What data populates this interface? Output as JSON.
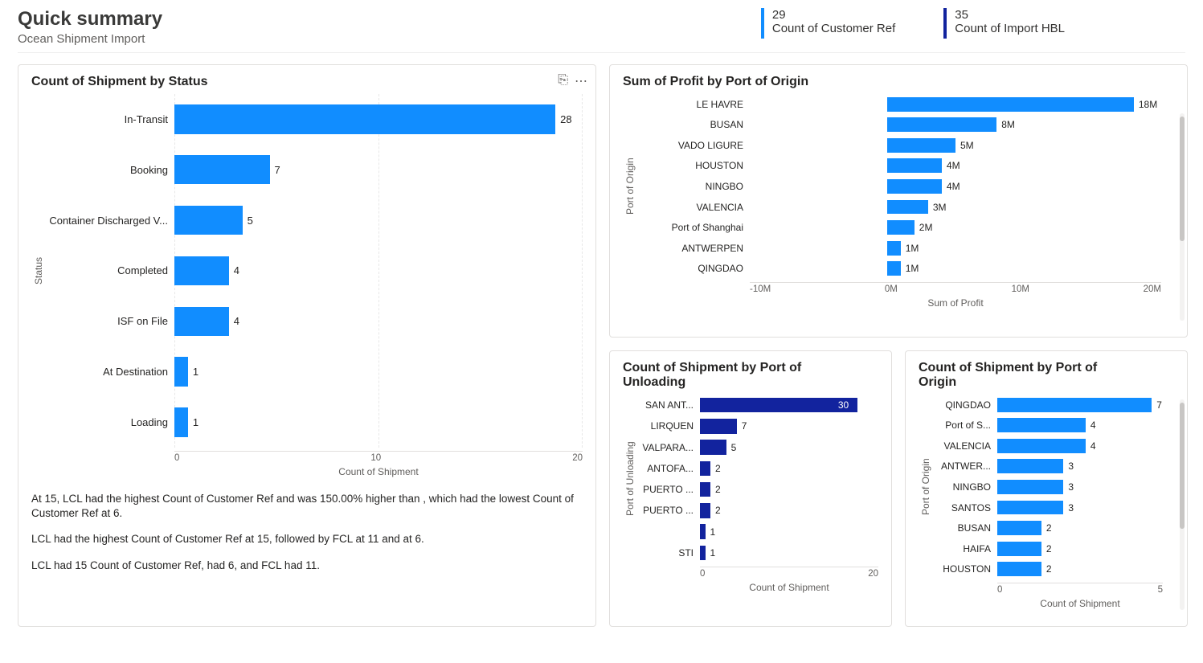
{
  "header": {
    "title": "Quick summary",
    "subtitle": "Ocean Shipment Import"
  },
  "kpis": [
    {
      "value": "29",
      "label": "Count of Customer Ref",
      "color": "#118dff"
    },
    {
      "value": "35",
      "label": "Count of Import HBL",
      "color": "#12239e"
    }
  ],
  "card1": {
    "title": "Count of Shipment by Status",
    "narrative": {
      "p1": "At 15, LCL had the highest Count of Customer Ref and was 150.00% higher than , which had the lowest Count of Customer Ref at 6.",
      "p2": "LCL had the highest Count of Customer Ref at 15, followed by FCL at 11 and  at 6.",
      "p3": "LCL had 15 Count of Customer Ref,  had 6, and FCL had 11."
    }
  },
  "card2": {
    "title": "Sum of Profit by Port of Origin"
  },
  "card3": {
    "title": "Count of Shipment by Port of Unloading"
  },
  "card4": {
    "title": "Count of Shipment by Port of Origin"
  },
  "chart_data": [
    {
      "id": "status",
      "type": "bar",
      "orientation": "horizontal",
      "title": "Count of Shipment by Status",
      "ylabel": "Status",
      "xlabel": "Count of Shipment",
      "xticks": [
        "0",
        "10",
        "20"
      ],
      "categories": [
        "In-Transit",
        "Booking",
        "Container Discharged V...",
        "Completed",
        "ISF on File",
        "At Destination",
        "Loading"
      ],
      "values": [
        28,
        7,
        5,
        4,
        4,
        1,
        1
      ],
      "color": "#118dff",
      "xlim": [
        0,
        30
      ]
    },
    {
      "id": "profit_origin",
      "type": "bar",
      "orientation": "horizontal",
      "title": "Sum of Profit by Port of Origin",
      "ylabel": "Port of Origin",
      "xlabel": "Sum of Profit",
      "xticks": [
        "-10M",
        "0M",
        "10M",
        "20M"
      ],
      "categories": [
        "LE HAVRE",
        "BUSAN",
        "VADO LIGURE",
        "HOUSTON",
        "NINGBO",
        "VALENCIA",
        "Port of Shanghai",
        "ANTWERPEN",
        "QINGDAO"
      ],
      "values": [
        18,
        8,
        5,
        4,
        4,
        3,
        2,
        1,
        1
      ],
      "value_labels": [
        "18M",
        "8M",
        "5M",
        "4M",
        "4M",
        "3M",
        "2M",
        "1M",
        "1M"
      ],
      "color": "#118dff",
      "xlim": [
        -10,
        20
      ]
    },
    {
      "id": "unload",
      "type": "bar",
      "orientation": "horizontal",
      "title": "Count of Shipment by Port of Unloading",
      "ylabel": "Port of Unloading",
      "xlabel": "Count of Shipment",
      "xticks": [
        "0",
        "20"
      ],
      "categories": [
        "SAN ANT...",
        "LIRQUEN",
        "VALPARA...",
        "ANTOFA...",
        "PUERTO ...",
        "PUERTO ...",
        "",
        "STI"
      ],
      "values": [
        30,
        7,
        5,
        2,
        2,
        2,
        1,
        1
      ],
      "color": "#12239e",
      "highlight_first_label_inside": true,
      "xlim": [
        0,
        34
      ]
    },
    {
      "id": "count_origin",
      "type": "bar",
      "orientation": "horizontal",
      "title": "Count of Shipment by Port of Origin",
      "ylabel": "Port of Origin",
      "xlabel": "Count of Shipment",
      "xticks": [
        "0",
        "5"
      ],
      "categories": [
        "QINGDAO",
        "Port of S...",
        "VALENCIA",
        "ANTWER...",
        "NINGBO",
        "SANTOS",
        "BUSAN",
        "HAIFA",
        "HOUSTON"
      ],
      "values": [
        7,
        4,
        4,
        3,
        3,
        3,
        2,
        2,
        2
      ],
      "color": "#118dff",
      "xlim": [
        0,
        7.5
      ]
    }
  ]
}
